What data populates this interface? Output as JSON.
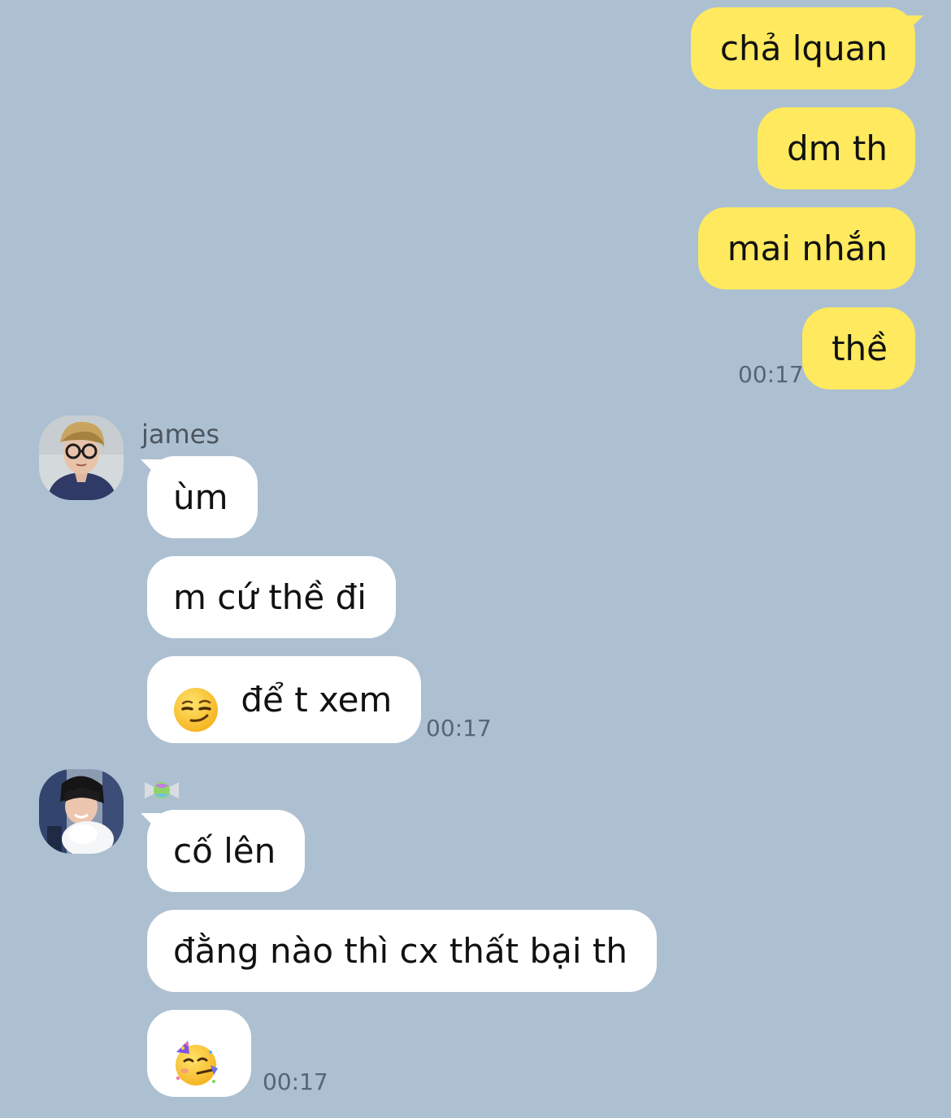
{
  "messages_outgoing": [
    {
      "text": "chả lquan"
    },
    {
      "text": "dm th"
    },
    {
      "text": "mai nhắn"
    },
    {
      "text": "thề",
      "time": "00:17"
    }
  ],
  "group_james": {
    "sender_name": "james",
    "messages": [
      {
        "text": "ùm"
      },
      {
        "text": "m cứ thề đi"
      },
      {
        "emoji": "smirking-face",
        "text": "để t xem",
        "time": "00:17"
      }
    ]
  },
  "group_candy": {
    "sender_icon": "candy-icon",
    "messages": [
      {
        "text": "cố lên"
      },
      {
        "text": "đằng nào thì cx thất bại th"
      },
      {
        "emoji": "partying-face",
        "time": "00:17"
      }
    ]
  },
  "colors": {
    "background": "#adc0d1",
    "outgoing_bubble": "#fee95f",
    "incoming_bubble": "#ffffff",
    "timestamp": "#556675"
  }
}
